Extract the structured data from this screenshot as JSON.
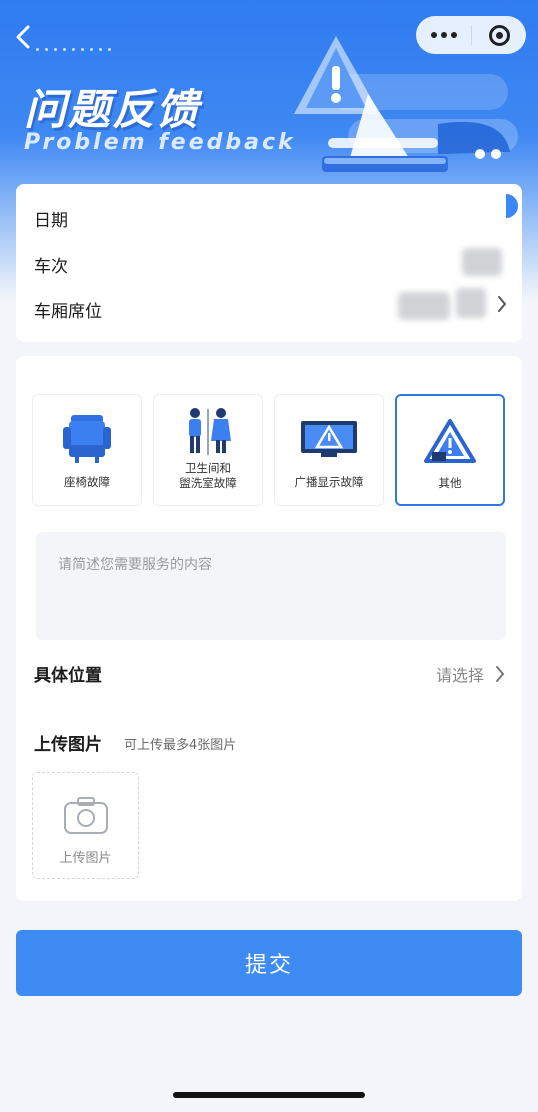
{
  "header": {
    "title_zh": "问题反馈",
    "title_en": "Problem  feedback"
  },
  "info": {
    "date_label": "日期",
    "train_label": "车次",
    "seat_label": "车厢席位"
  },
  "issue_types": [
    {
      "label": "座椅故障",
      "icon": "seat-icon",
      "selected": false
    },
    {
      "label": "卫生间和\n盥洗室故障",
      "icon": "restroom-icon",
      "selected": false
    },
    {
      "label": "广播显示故障",
      "icon": "display-warning-icon",
      "selected": false
    },
    {
      "label": "其他",
      "icon": "warning-triangle-icon",
      "selected": true
    }
  ],
  "description": {
    "placeholder": "请简述您需要服务的内容"
  },
  "location": {
    "label": "具体位置",
    "value": "请选择"
  },
  "upload": {
    "label": "上传图片",
    "hint": "可上传最多4张图片",
    "button_label": "上传图片"
  },
  "submit_label": "提交",
  "colors": {
    "accent": "#3e8bf3",
    "selected_border": "#3277e0",
    "hero_blue": "#2f7cf0"
  }
}
